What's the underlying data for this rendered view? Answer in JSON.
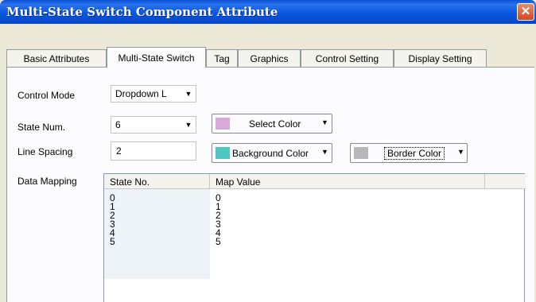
{
  "window": {
    "title": "Multi-State Switch Component Attribute",
    "close_glyph": "✕"
  },
  "tabs": [
    "Basic Attributes",
    "Multi-State Switch",
    "Tag",
    "Graphics",
    "Control Setting",
    "Display Setting"
  ],
  "active_tab": "Multi-State Switch",
  "form": {
    "control_mode_label": "Control Mode",
    "control_mode_value": "Dropdown L",
    "state_num_label": "State Num.",
    "state_num_value": "6",
    "line_spacing_label": "Line Spacing",
    "line_spacing_value": "2",
    "select_color_label": "Select Color",
    "background_color_label": "Background Color",
    "border_color_label": "Border Color",
    "data_mapping_label": "Data Mapping",
    "dropdown_glyph": "▼"
  },
  "colors": {
    "select_color": "#d9a9d9",
    "background_color": "#4fc6c2",
    "border_color": "#b8b8b8"
  },
  "table": {
    "headers": [
      "State No.",
      "Map Value"
    ],
    "rows": [
      [
        "0",
        "0"
      ],
      [
        "1",
        "1"
      ],
      [
        "2",
        "2"
      ],
      [
        "3",
        "3"
      ],
      [
        "4",
        "4"
      ],
      [
        "5",
        "5"
      ]
    ]
  }
}
